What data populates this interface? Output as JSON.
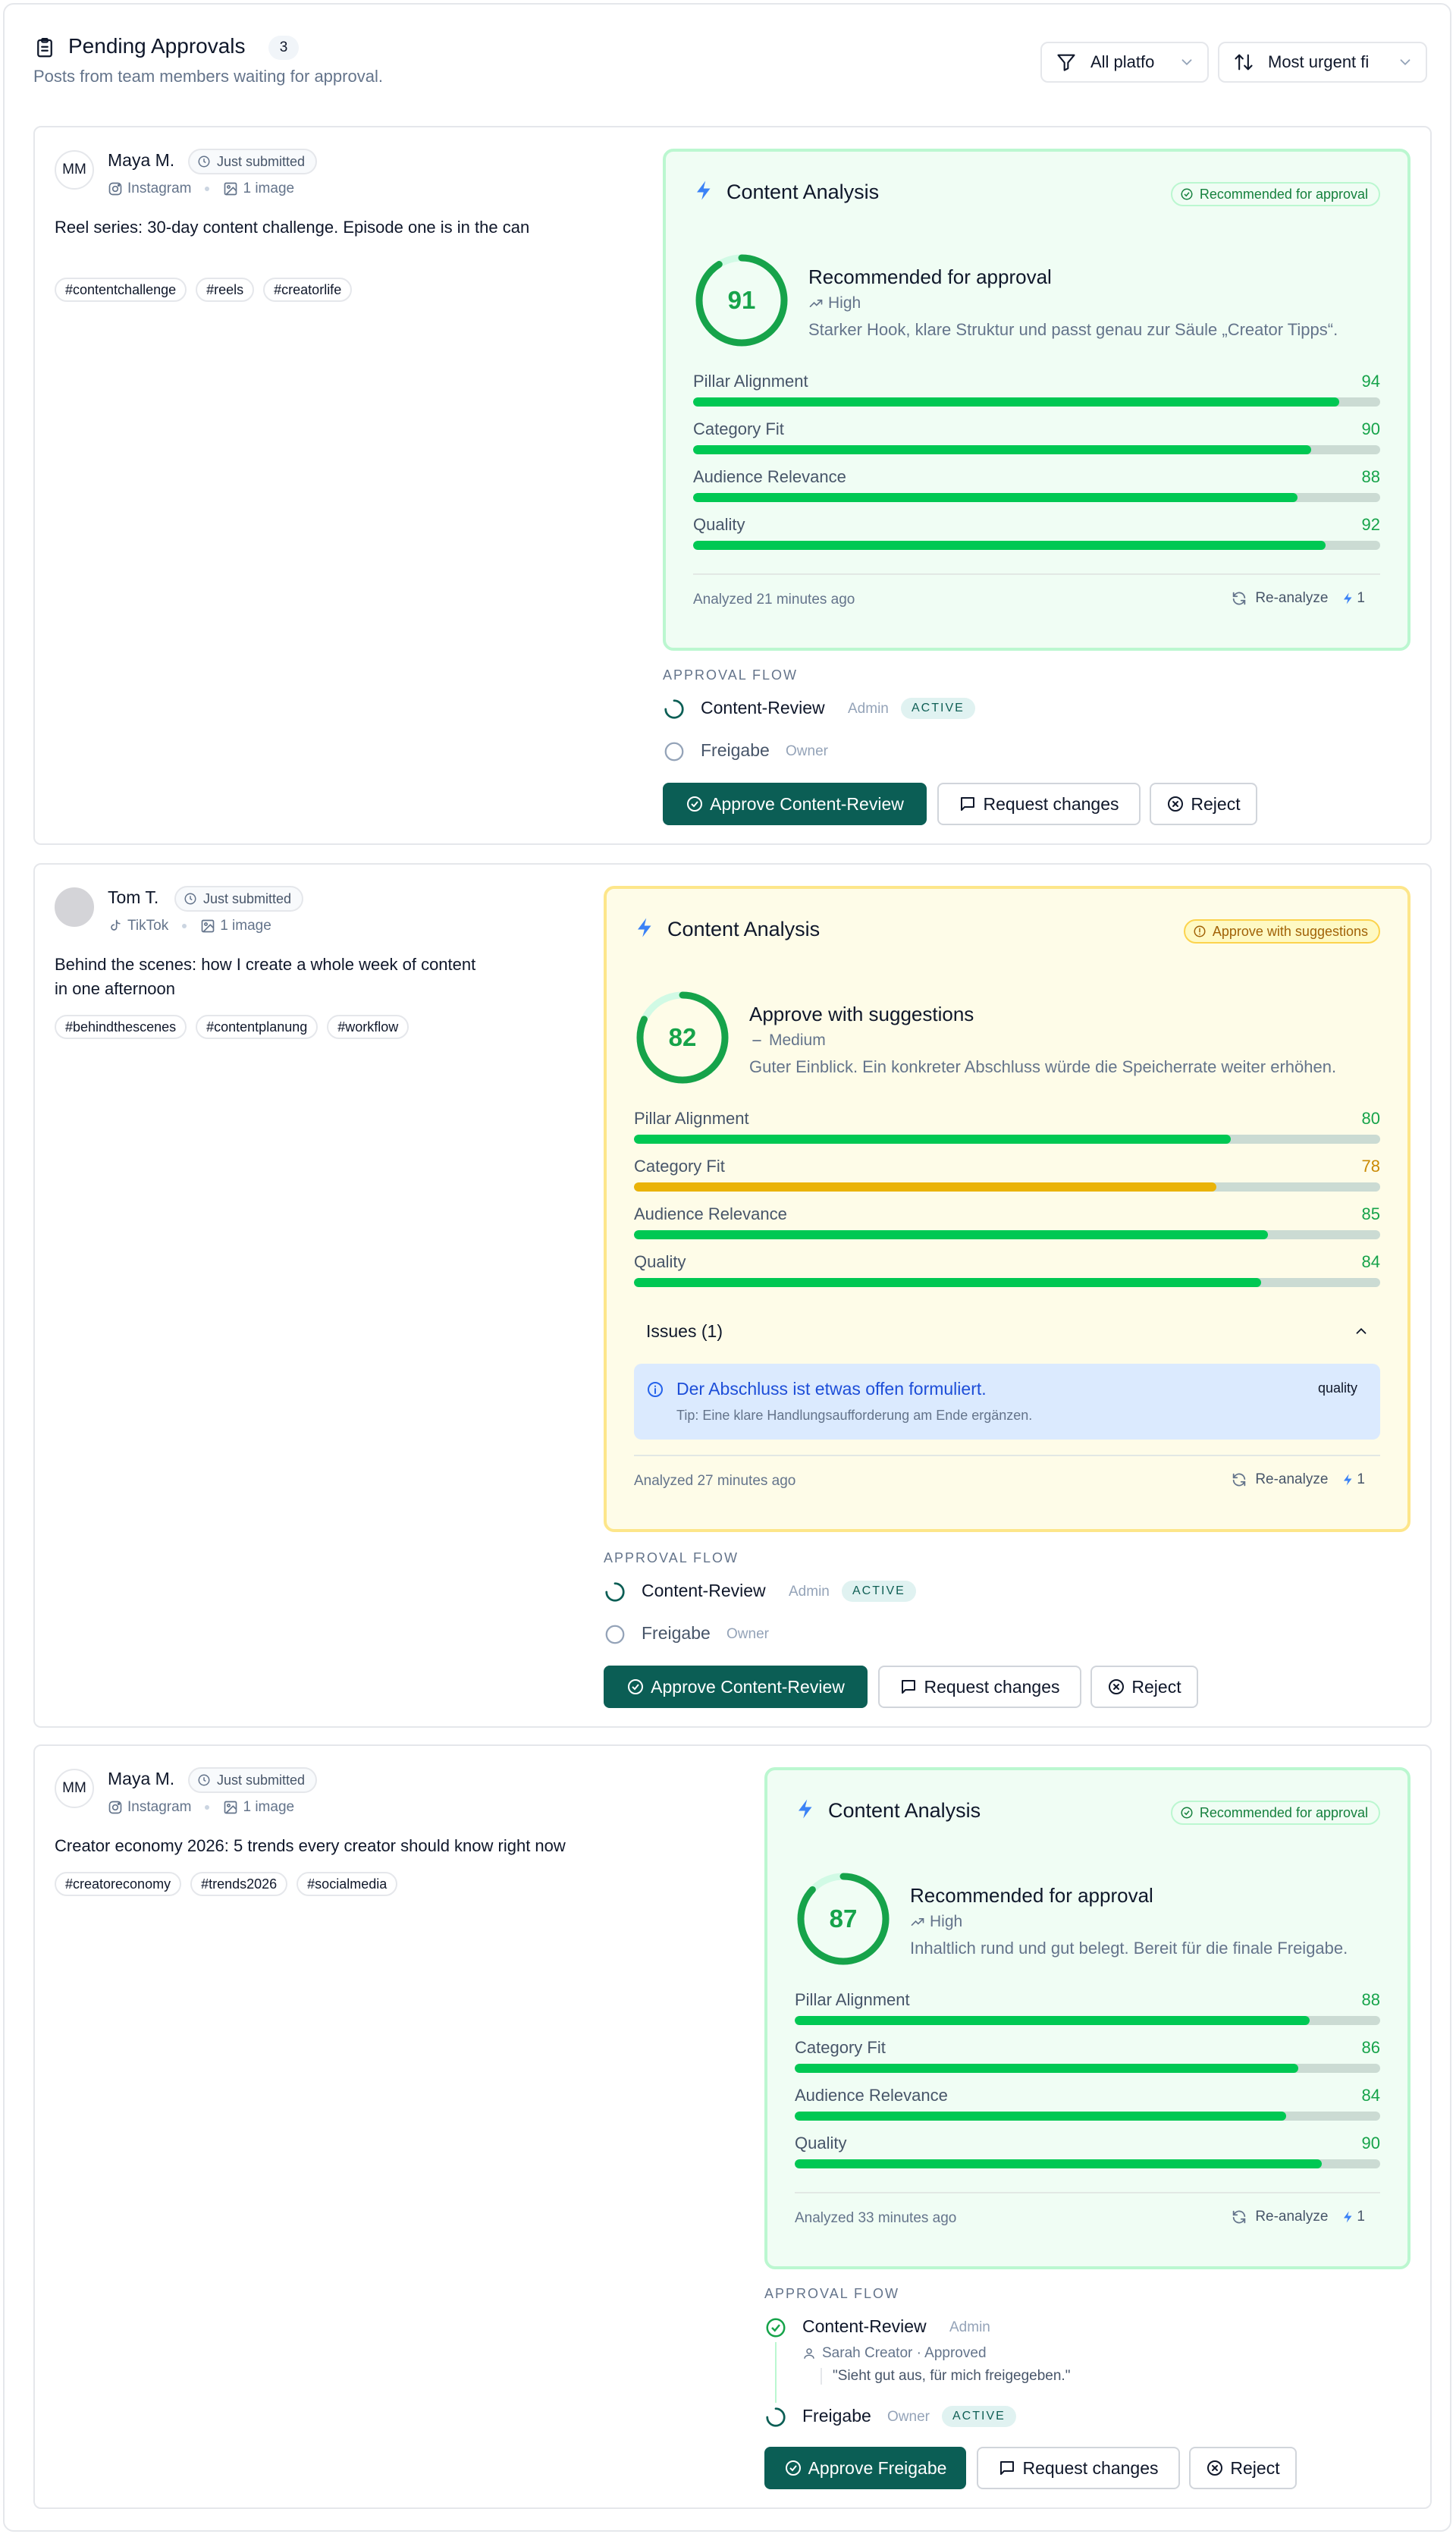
{
  "header": {
    "title": "Pending Approvals",
    "count": "3",
    "subtitle": "Posts from team members waiting for approval.",
    "filter_platform": "All platfo",
    "sort_label": "Most urgent fi"
  },
  "colors": {
    "primary": "#0b5e55",
    "score_green": "#16a34a",
    "bar_green": "#00c853",
    "bar_yellow": "#eab308"
  },
  "posts": [
    {
      "author": "Maya M.",
      "initials": "MM",
      "status_badge": "Just submitted",
      "platform": "Instagram",
      "media": "1 image",
      "text": "Reel series: 30-day content challenge. Episode one is in the can",
      "tags": [
        "#contentchallenge",
        "#reels",
        "#creatorlife"
      ],
      "analysis": {
        "title": "Content Analysis",
        "badge": "Recommended for approval",
        "score": 91,
        "recommendation": "Recommended for approval",
        "level": "High",
        "description": "Starker Hook, klare Struktur und passt genau zur Säule „Creator Tipps“.",
        "metrics": [
          {
            "label": "Pillar Alignment",
            "value": 94
          },
          {
            "label": "Category Fit",
            "value": 90
          },
          {
            "label": "Audience Relevance",
            "value": 88
          },
          {
            "label": "Quality",
            "value": 92
          }
        ],
        "analyzed": "Analyzed 21 minutes ago",
        "reanalyze": "Re-analyze",
        "reanalyze_count": "1"
      },
      "flow": {
        "header": "APPROVAL FLOW",
        "steps": [
          {
            "name": "Content-Review",
            "role": "Admin",
            "status": "ACTIVE"
          },
          {
            "name": "Freigabe",
            "role": "Owner"
          }
        ]
      },
      "actions": {
        "approve": "Approve Content-Review",
        "request": "Request changes",
        "reject": "Reject"
      }
    },
    {
      "author": "Tom T.",
      "initials": "",
      "status_badge": "Just submitted",
      "platform": "TikTok",
      "media": "1 image",
      "text": "Behind the scenes: how I create a whole week of content in one afternoon",
      "tags": [
        "#behindthescenes",
        "#contentplanung",
        "#workflow"
      ],
      "analysis": {
        "title": "Content Analysis",
        "badge": "Approve with suggestions",
        "score": 82,
        "recommendation": "Approve with suggestions",
        "level": "Medium",
        "description": "Guter Einblick. Ein konkreter Abschluss würde die Speicherrate weiter erhöhen.",
        "metrics": [
          {
            "label": "Pillar Alignment",
            "value": 80
          },
          {
            "label": "Category Fit",
            "value": 78
          },
          {
            "label": "Audience Relevance",
            "value": 85
          },
          {
            "label": "Quality",
            "value": 84
          }
        ],
        "issues_label": "Issues (1)",
        "issue": {
          "text": "Der Abschluss ist etwas offen formuliert.",
          "tip": "Tip: Eine klare Handlungsaufforderung am Ende ergänzen.",
          "category": "quality"
        },
        "analyzed": "Analyzed 27 minutes ago",
        "reanalyze": "Re-analyze",
        "reanalyze_count": "1"
      },
      "flow": {
        "header": "APPROVAL FLOW",
        "steps": [
          {
            "name": "Content-Review",
            "role": "Admin",
            "status": "ACTIVE"
          },
          {
            "name": "Freigabe",
            "role": "Owner"
          }
        ]
      },
      "actions": {
        "approve": "Approve Content-Review",
        "request": "Request changes",
        "reject": "Reject"
      }
    },
    {
      "author": "Maya M.",
      "initials": "MM",
      "status_badge": "Just submitted",
      "platform": "Instagram",
      "media": "1 image",
      "text": "Creator economy 2026: 5 trends every creator should know right now",
      "tags": [
        "#creatoreconomy",
        "#trends2026",
        "#socialmedia"
      ],
      "analysis": {
        "title": "Content Analysis",
        "badge": "Recommended for approval",
        "score": 87,
        "recommendation": "Recommended for approval",
        "level": "High",
        "description": "Inhaltlich rund und gut belegt. Bereit für die finale Freigabe.",
        "metrics": [
          {
            "label": "Pillar Alignment",
            "value": 88
          },
          {
            "label": "Category Fit",
            "value": 86
          },
          {
            "label": "Audience Relevance",
            "value": 84
          },
          {
            "label": "Quality",
            "value": 90
          }
        ],
        "analyzed": "Analyzed 33 minutes ago",
        "reanalyze": "Re-analyze",
        "reanalyze_count": "1"
      },
      "flow": {
        "header": "APPROVAL FLOW",
        "steps": [
          {
            "name": "Content-Review",
            "role": "Admin",
            "approved_by": "Sarah Creator · Approved",
            "comment": "\"Sieht gut aus, für mich freigegeben.\""
          },
          {
            "name": "Freigabe",
            "role": "Owner",
            "status": "ACTIVE"
          }
        ]
      },
      "actions": {
        "approve": "Approve Freigabe",
        "request": "Request changes",
        "reject": "Reject"
      }
    }
  ]
}
